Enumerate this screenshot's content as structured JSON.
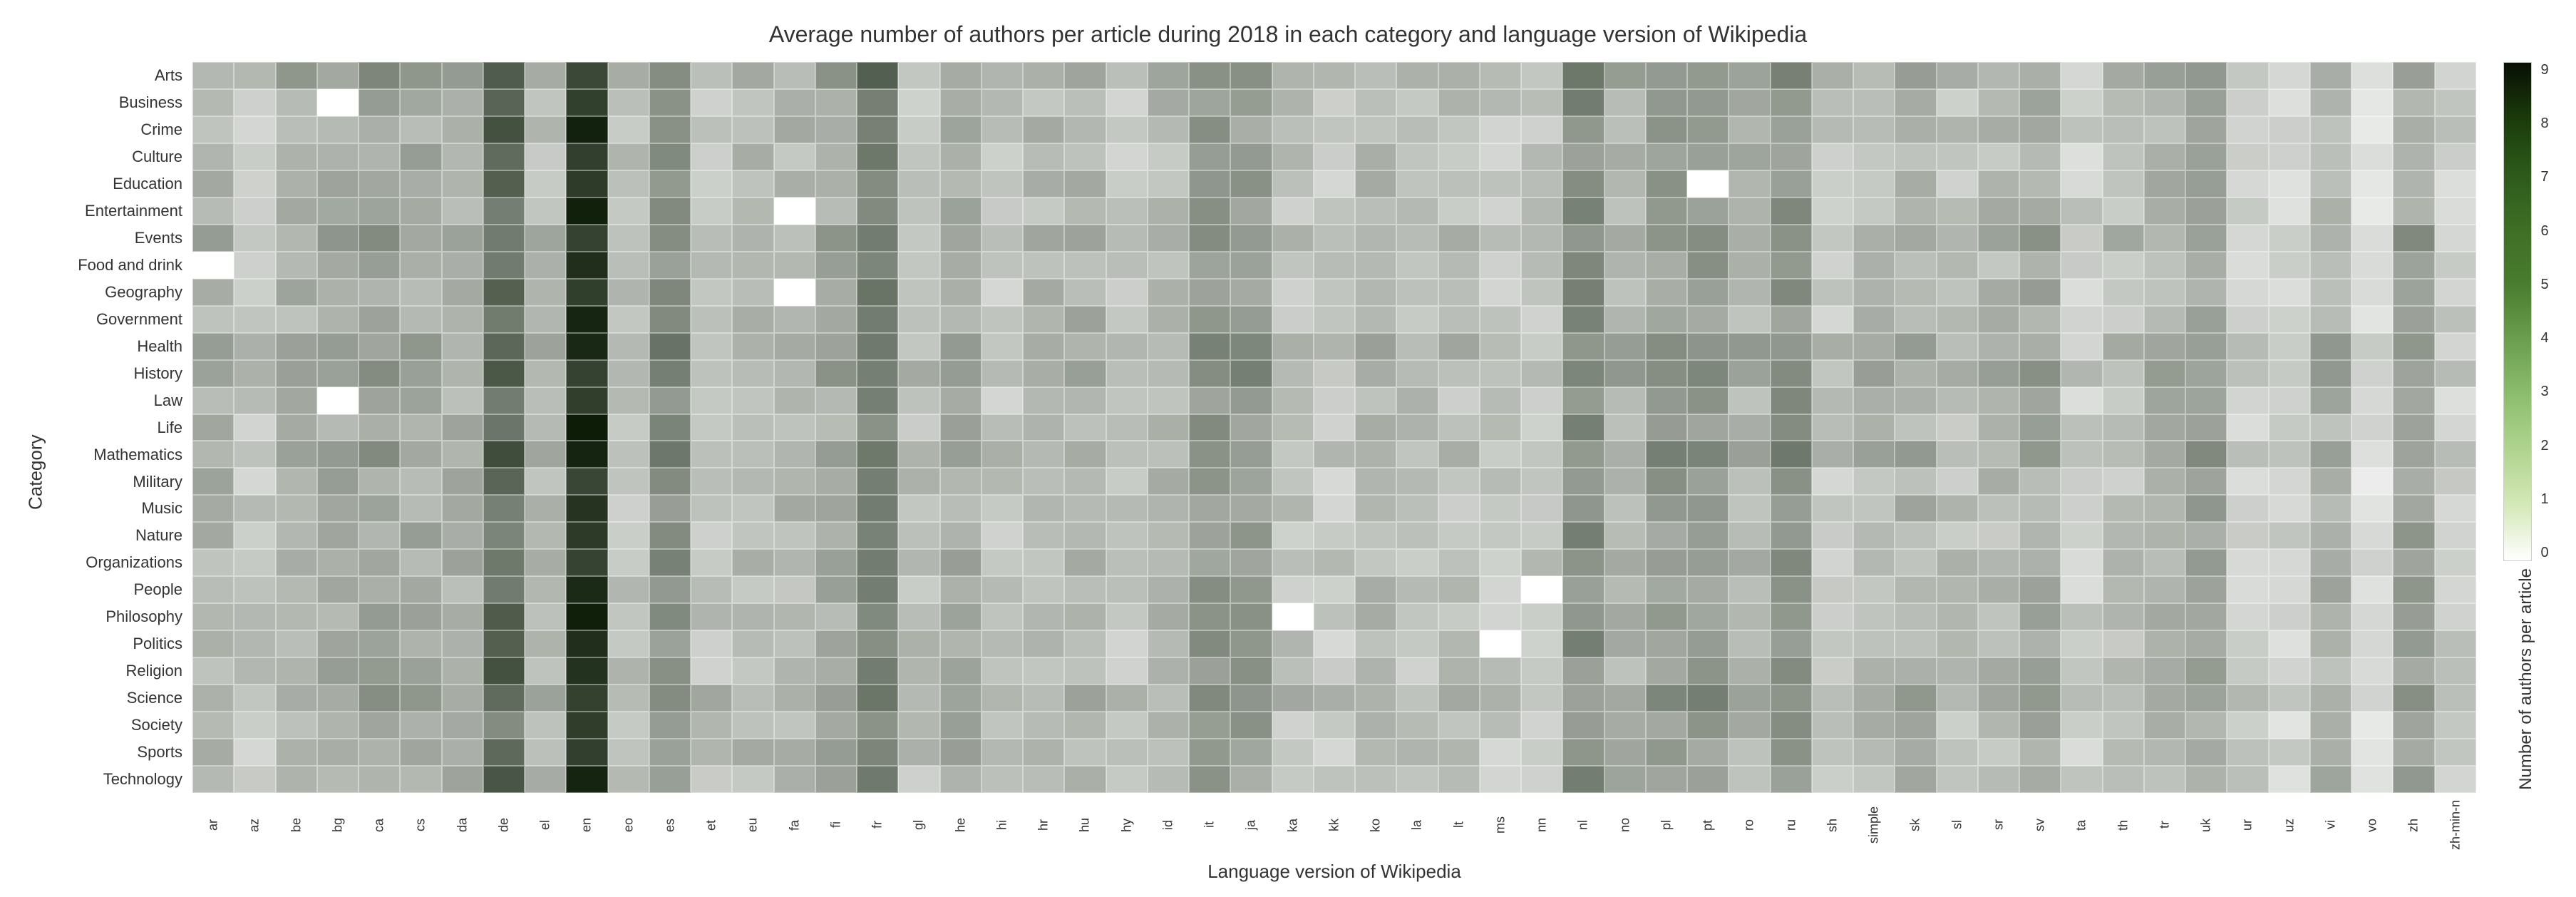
{
  "title": "Average number of authors per article during 2018 in each category and language version of Wikipedia",
  "xAxisLabel": "Language version of Wikipedia",
  "yAxisLabel": "Category",
  "legendLabel": "Number of authors per article",
  "categories": [
    "Arts",
    "Business",
    "Crime",
    "Culture",
    "Education",
    "Entertainment",
    "Events",
    "Food and drink",
    "Geography",
    "Government",
    "Health",
    "History",
    "Law",
    "Life",
    "Mathematics",
    "Military",
    "Music",
    "Nature",
    "Organizations",
    "People",
    "Philosophy",
    "Politics",
    "Religion",
    "Science",
    "Society",
    "Sports",
    "Technology"
  ],
  "languages": [
    "ar",
    "az",
    "be",
    "bg",
    "ca",
    "cs",
    "da",
    "de",
    "el",
    "en",
    "eo",
    "es",
    "et",
    "eu",
    "fa",
    "fi",
    "fr",
    "gl",
    "he",
    "hi",
    "hr",
    "hu",
    "hy",
    "id",
    "it",
    "ja",
    "ka",
    "kk",
    "ko",
    "la",
    "lt",
    "ms",
    "nn",
    "nl",
    "no",
    "pl",
    "pt",
    "ro",
    "ru",
    "sh",
    "simple",
    "sk",
    "sl",
    "sr",
    "sv",
    "ta",
    "th",
    "tr",
    "uk",
    "ur",
    "uz",
    "vi",
    "vo",
    "zh",
    "zh-min-n"
  ],
  "legendTicks": [
    "9",
    "8",
    "7",
    "6",
    "5",
    "4",
    "3",
    "2",
    "1",
    "0"
  ],
  "colors": {
    "max": "#0a1a05",
    "high": "#1f3d0c",
    "medHigh": "#2d5a1b",
    "med": "#4a7c2f",
    "medLow": "#6b9e4e",
    "low": "#8cbd6e",
    "veryLow": "#b0d48f",
    "pale": "#d4e8b8",
    "veryPale": "#edf5e0",
    "none": "#ffffff"
  }
}
